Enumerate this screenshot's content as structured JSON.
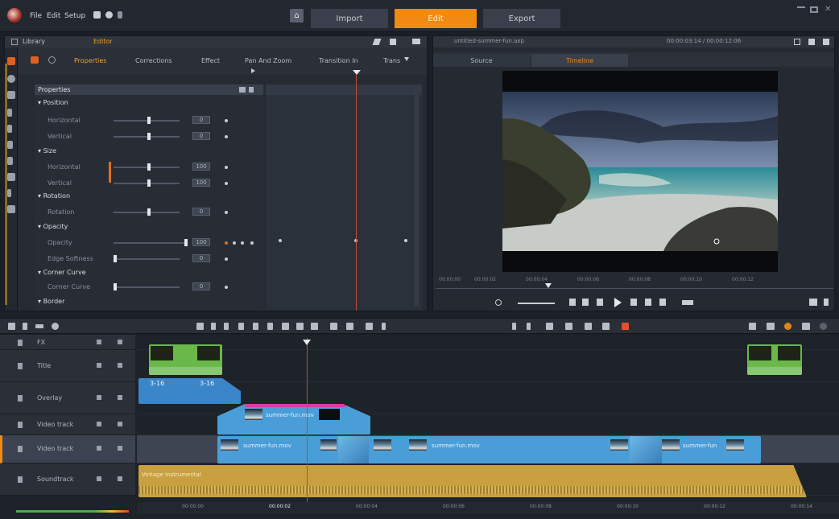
{
  "menu": [
    "File",
    "Edit",
    "Setup"
  ],
  "modes": {
    "import": "Import",
    "edit": "Edit",
    "export": "Export"
  },
  "library": {
    "library_tab": "Library",
    "editor_tab": "Editor"
  },
  "prop_tabs": [
    "Properties",
    "Corrections",
    "Effect",
    "Pan And Zoom",
    "Transition In",
    "Trans"
  ],
  "properties": {
    "header": "Properties",
    "groups": [
      {
        "name": "Position",
        "rows": [
          {
            "label": "Horizontal",
            "value": "0"
          },
          {
            "label": "Vertical",
            "value": "0"
          }
        ]
      },
      {
        "name": "Size",
        "rows": [
          {
            "label": "Horizontal",
            "value": "100"
          },
          {
            "label": "Vertical",
            "value": "100"
          }
        ]
      },
      {
        "name": "Rotation",
        "rows": [
          {
            "label": "Rotation",
            "value": "0"
          }
        ]
      },
      {
        "name": "Opacity",
        "rows": [
          {
            "label": "Opacity",
            "value": "100"
          },
          {
            "label": "Edge Softness",
            "value": "0"
          }
        ]
      },
      {
        "name": "Corner Curve",
        "rows": [
          {
            "label": "Corner Curve",
            "value": "0"
          }
        ]
      },
      {
        "name": "Border",
        "rows": []
      }
    ]
  },
  "preview": {
    "filename": "untitled-summer-fun.axp",
    "timecode": "00:00:03:14 / 00:00:12:06",
    "tabs": {
      "source": "Source",
      "timeline": "Timeline"
    },
    "ruler": [
      "00:00:00",
      "00:00:02",
      "00:00:04",
      "00:00:06",
      "00:00:08",
      "00:00:10",
      "00:00:12"
    ]
  },
  "tracks": [
    {
      "name": "FX"
    },
    {
      "name": "Title"
    },
    {
      "name": "Overlay"
    },
    {
      "name": "Video track"
    },
    {
      "name": "Video track"
    },
    {
      "name": "Soundtrack"
    }
  ],
  "clips": {
    "overlay_label": "3-16",
    "video_a": "summer-fun.mov",
    "video_b": "summer-fun.mov",
    "video_c": "summer-fun.mov",
    "video_d": "summer-fun",
    "soundtrack": "Vintage Instrumental"
  },
  "timeline_ruler": [
    "00:00:00",
    "00:00:02",
    "00:00:04",
    "00:00:06",
    "00:00:08",
    "00:00:10",
    "00:00:12",
    "00:00:14"
  ],
  "colors": {
    "accent": "#f08a12",
    "overlay_clip": "#3a86c8",
    "video_clip": "#4a9ed8",
    "title_clip": "#6ab84a",
    "audio_clip": "#c8a040"
  }
}
